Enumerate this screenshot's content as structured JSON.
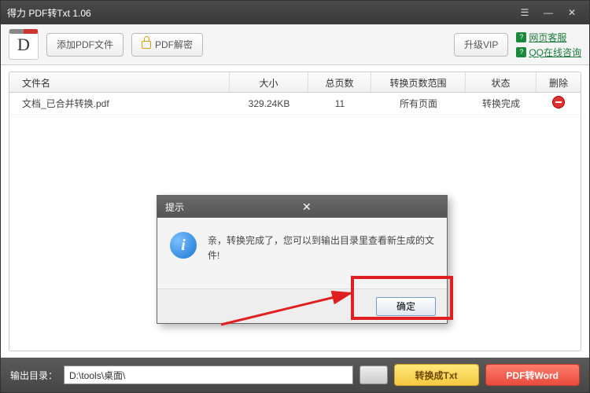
{
  "window": {
    "title": "得力 PDF转Txt 1.06"
  },
  "toolbar": {
    "add_label": "添加PDF文件",
    "decrypt_label": "PDF解密",
    "upgrade_label": "升级VIP"
  },
  "links": {
    "web_support": "网页客服",
    "qq_support": "QQ在线咨询"
  },
  "table": {
    "headers": {
      "name": "文件名",
      "size": "大小",
      "pages": "总页数",
      "range": "转换页数范围",
      "status": "状态",
      "delete": "删除"
    },
    "row": {
      "name": "文档_已合并转换.pdf",
      "size": "329.24KB",
      "pages": "11",
      "range": "所有页面",
      "status": "转换完成"
    }
  },
  "dialog": {
    "title": "提示",
    "message": "亲，转换完成了，您可以到输出目录里查看新生成的文件!",
    "ok": "确定"
  },
  "footer": {
    "label": "输出目录：",
    "path": "D:\\tools\\桌面\\",
    "convert_txt": "转换成Txt",
    "convert_word": "PDF转Word"
  }
}
